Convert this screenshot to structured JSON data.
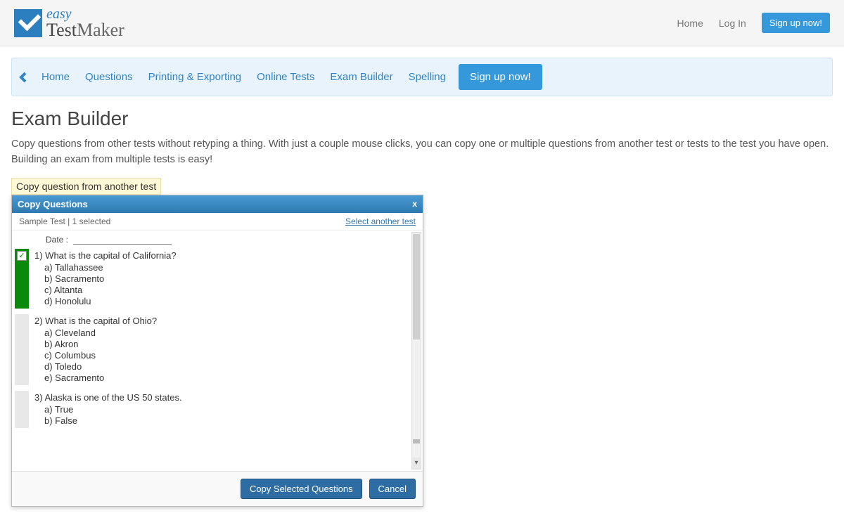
{
  "brand": {
    "easy": "easy",
    "test": "Test",
    "maker": "Maker"
  },
  "topnav": {
    "home": "Home",
    "login": "Log In",
    "signup": "Sign up now!"
  },
  "subnav": {
    "home": "Home",
    "questions": "Questions",
    "printing": "Printing & Exporting",
    "online": "Online Tests",
    "builder": "Exam Builder",
    "spelling": "Spelling",
    "signup": "Sign up now!"
  },
  "page": {
    "title": "Exam Builder",
    "desc": "Copy questions from other tests without retyping a thing. With just a couple mouse clicks, you can copy one or multiple questions from another test or tests to the test you have open. Building an exam from multiple tests is easy!",
    "caption": "Copy question from another test"
  },
  "modal": {
    "title": "Copy Questions",
    "close": "x",
    "subleft": "Sample Test | 1 selected",
    "subright": "Select another test",
    "date_label": "Date :",
    "questions": [
      {
        "selected": true,
        "text": "1) What is the capital of California?",
        "opts": [
          "a) Tallahassee",
          "b) Sacramento",
          "c) Altanta",
          "d) Honolulu"
        ]
      },
      {
        "selected": false,
        "text": "2) What is the capital of Ohio?",
        "opts": [
          "a) Cleveland",
          "b) Akron",
          "c) Columbus",
          "d) Toledo",
          "e) Sacramento"
        ]
      },
      {
        "selected": false,
        "text": "3) Alaska is one of the US 50 states.",
        "opts": [
          "a) True",
          "b) False"
        ]
      }
    ],
    "copy_btn": "Copy Selected Questions",
    "cancel_btn": "Cancel"
  }
}
